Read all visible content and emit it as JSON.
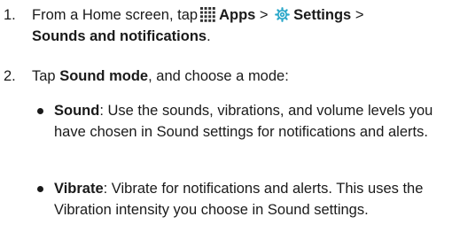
{
  "steps": [
    {
      "number": "1.",
      "prefix": "From a Home screen, tap",
      "apps": "Apps",
      "sep1": " > ",
      "settings": "Settings",
      "sep2": " >",
      "destination": "Sounds and notifications",
      "end": "."
    },
    {
      "number": "2.",
      "prefix": "Tap ",
      "bold": "Sound mode",
      "suffix": ", and choose a mode:"
    }
  ],
  "options": [
    {
      "name": "Sound",
      "description": ": Use the sounds, vibrations, and volume levels you have chosen in Sound settings for notifications and alerts."
    },
    {
      "name": "Vibrate",
      "description": ": Vibrate for notifications and alerts. This uses the Vibration intensity you choose in Sound settings."
    }
  ],
  "icons": {
    "apps": "apps-grid-icon",
    "settings": "settings-gear-icon",
    "settings_color": "#2aa7c9"
  }
}
